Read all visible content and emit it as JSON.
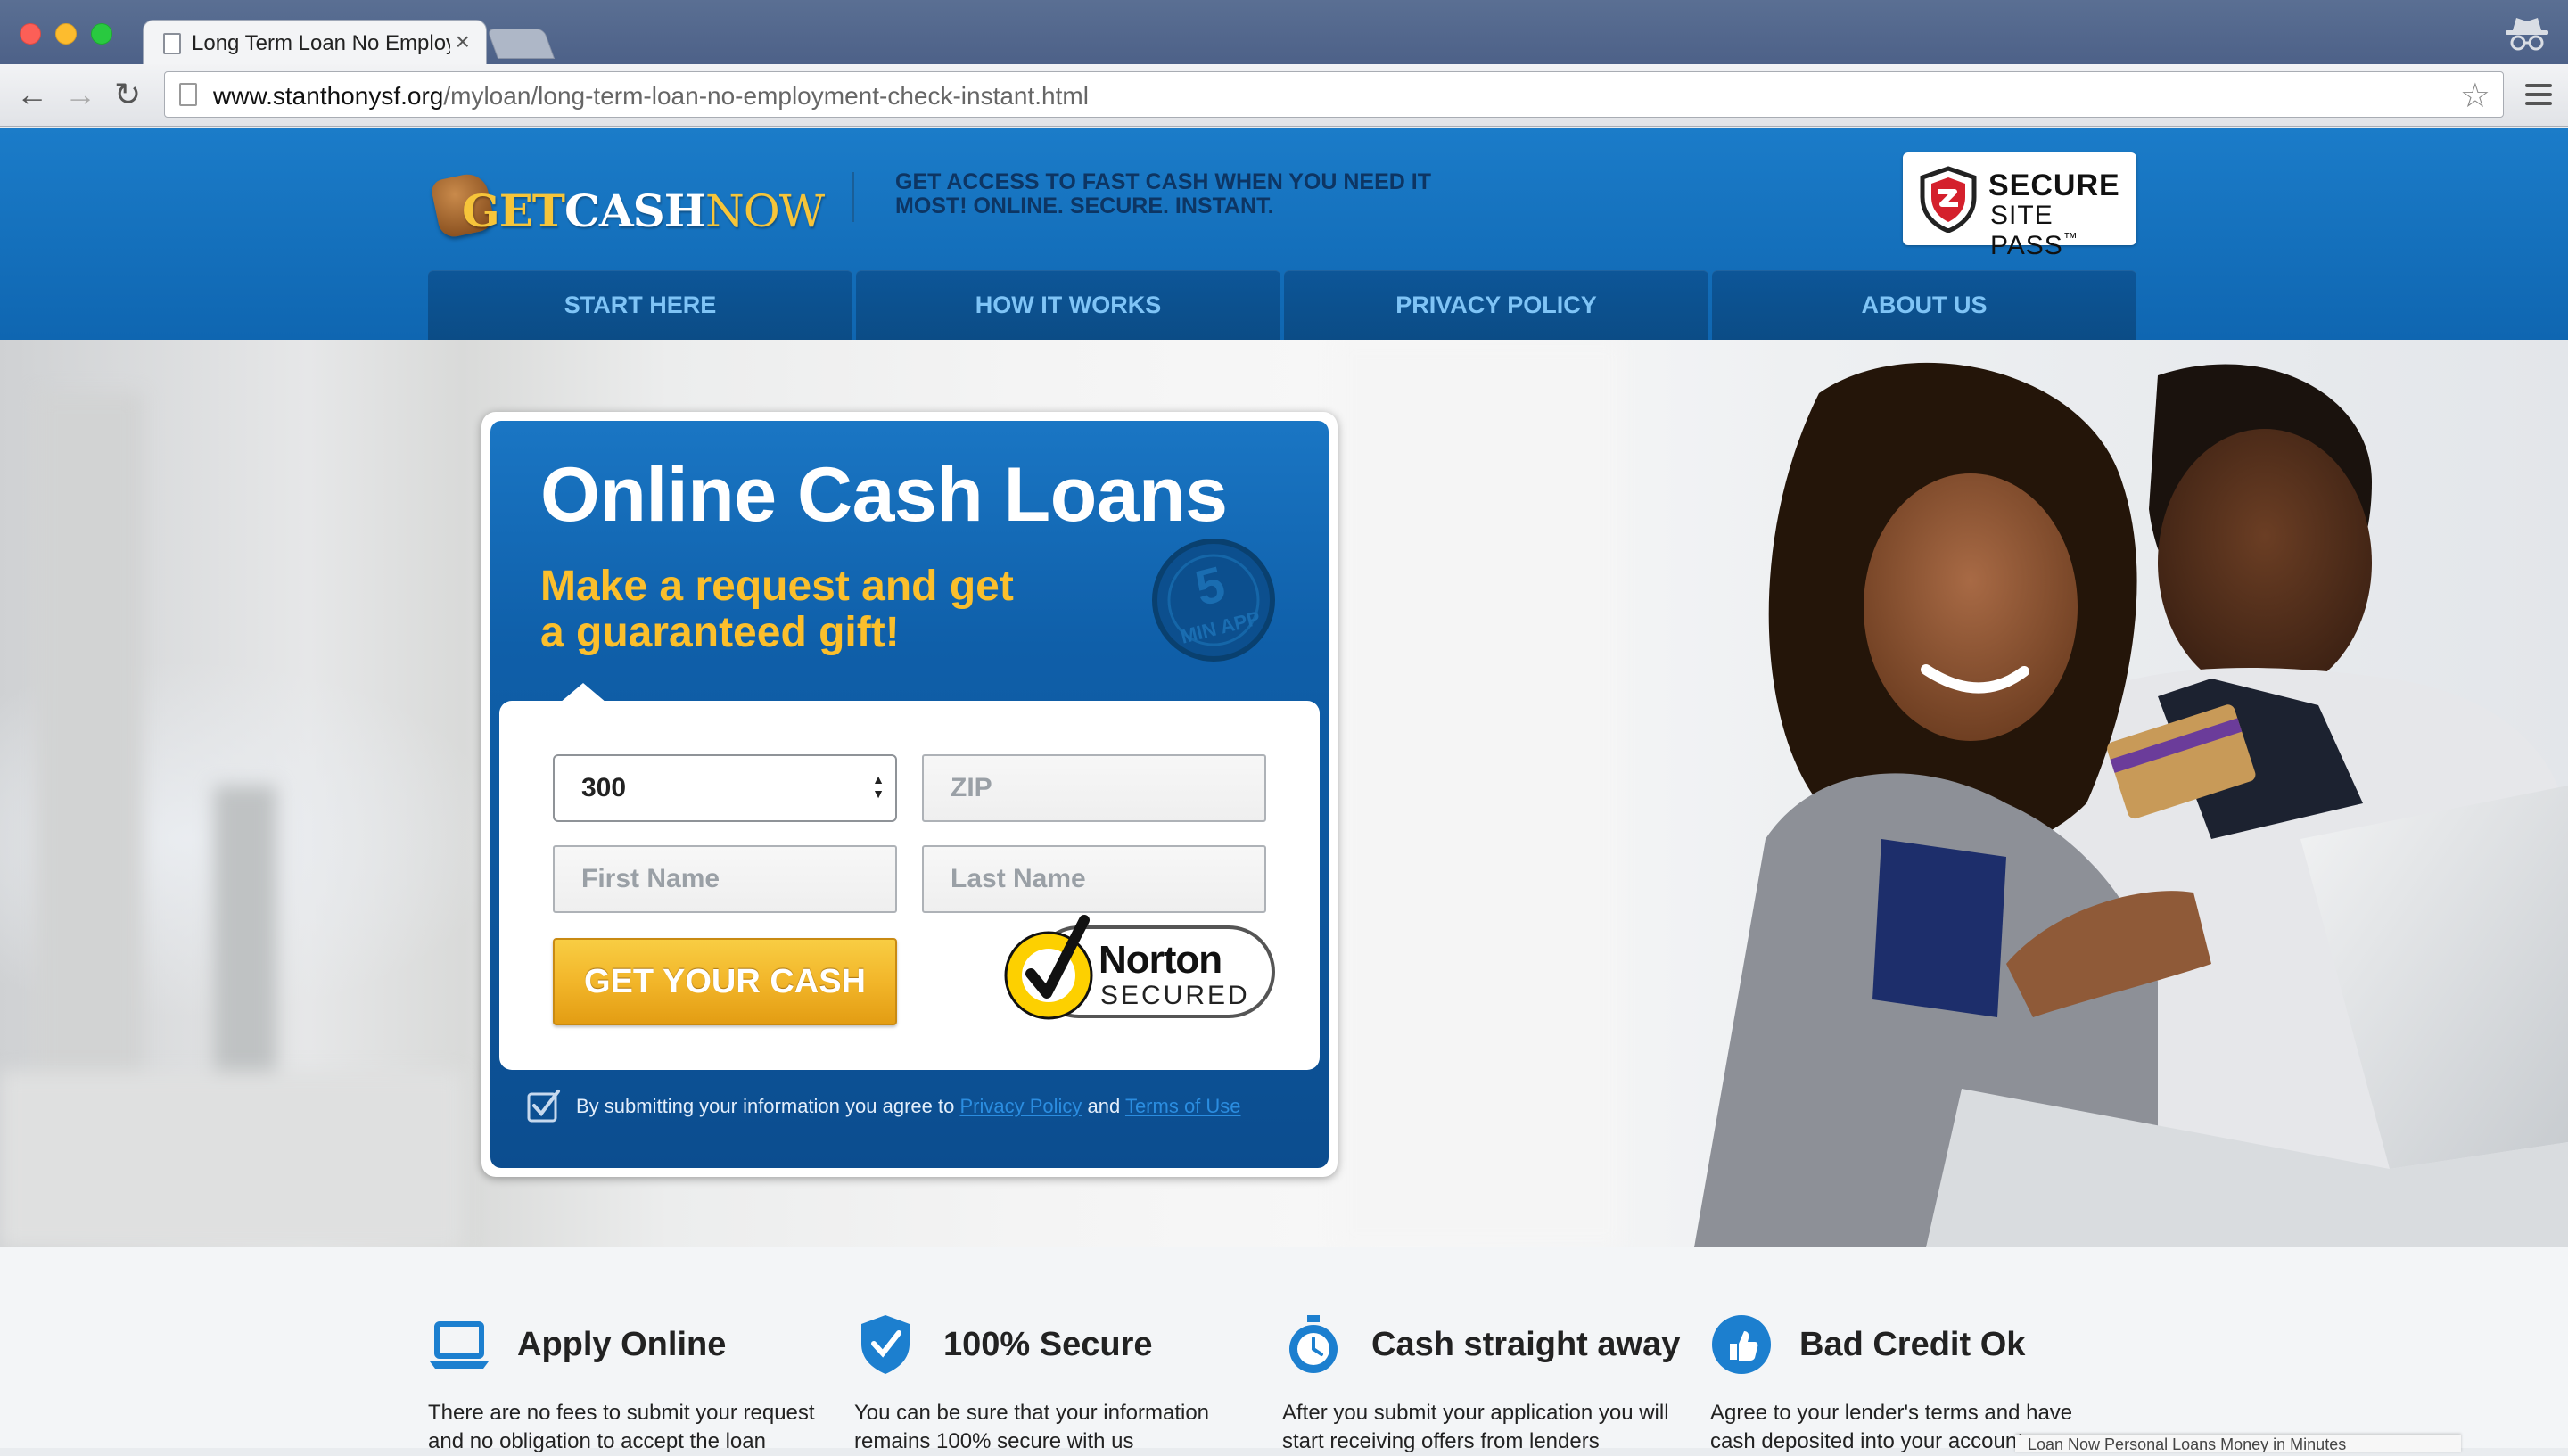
{
  "browser": {
    "tab_title": "Long Term Loan No Employ",
    "tab_close": "×",
    "url_host": "www.stanthonysf.org",
    "url_path": "/myloan/long-term-loan-no-employment-check-instant.html"
  },
  "header": {
    "logo": {
      "get": "GET",
      "cash": "CASH",
      "now": "NOW"
    },
    "tagline": "GET ACCESS TO FAST CASH WHEN YOU NEED IT MOST! ONLINE. SECURE. INSTANT.",
    "secure_badge": {
      "line1": "SECURE",
      "line2": "SITE PASS",
      "tm": "™"
    }
  },
  "nav": {
    "items": [
      {
        "label": "START HERE"
      },
      {
        "label": "HOW IT WORKS"
      },
      {
        "label": "PRIVACY POLICY"
      },
      {
        "label": "ABOUT US"
      }
    ]
  },
  "form": {
    "heading": "Online Cash Loans",
    "subheading": "Make a request and get a guaranteed gift!",
    "badge": {
      "number": "5",
      "text": "MIN APP"
    },
    "amount_value": "300",
    "zip_placeholder": "ZIP",
    "first_name_placeholder": "First Name",
    "last_name_placeholder": "Last Name",
    "submit_label": "GET YOUR CASH",
    "norton": {
      "name": "Norton",
      "sub": "SECURED"
    },
    "consent": {
      "prefix": "By submitting your information you agree to",
      "privacy_link": "Privacy Policy",
      "and": "and",
      "terms_link": "Terms of Use"
    }
  },
  "features": [
    {
      "icon": "laptop-icon",
      "title": "Apply Online",
      "text": "There are no fees to submit your request and no obligation to accept the loan"
    },
    {
      "icon": "shield-check-icon",
      "title": "100% Secure",
      "text": "You can be sure that your information remains 100% secure with us"
    },
    {
      "icon": "stopwatch-icon",
      "title": "Cash straight away",
      "text": "After you submit your application you will start receiving offers from lenders"
    },
    {
      "icon": "thumbs-up-icon",
      "title": "Bad Credit Ok",
      "text": "Agree to your lender's terms and have cash deposited into your account"
    }
  ],
  "popup_text": "Loan Now Personal Loans Money in Minutes",
  "colors": {
    "header_blue": "#1474c2",
    "nav_tab": "#0c5190",
    "nav_text": "#7fc4f6",
    "accent_yellow": "#fbbf2c",
    "button_gold": "#f2b62a"
  }
}
